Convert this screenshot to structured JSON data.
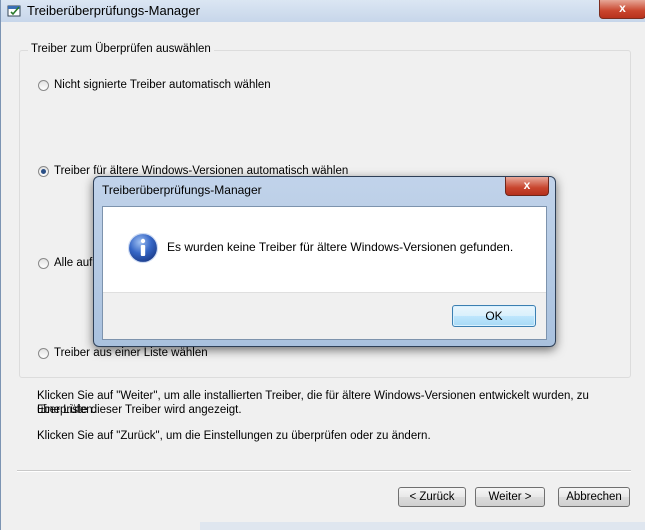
{
  "window": {
    "title": "Treiberüberprüfungs-Manager",
    "close_glyph": "x"
  },
  "group": {
    "legend": "Treiber zum Überprüfen auswählen",
    "options": [
      {
        "label": "Nicht signierte Treiber automatisch wählen",
        "checked": false
      },
      {
        "label": "Treiber für ältere Windows-Versionen automatisch wählen",
        "checked": true
      },
      {
        "label": "Alle auf d",
        "checked": false
      },
      {
        "label": "Treiber aus einer Liste wählen",
        "checked": false
      }
    ]
  },
  "description": {
    "line1": "Klicken Sie auf \"Weiter\", um alle installierten Treiber, die für ältere Windows-Versionen entwickelt wurden, zu überprüfen.",
    "line2": "Eine Liste dieser Treiber wird angezeigt.",
    "line3": "Klicken Sie auf \"Zurück\", um die Einstellungen zu überprüfen oder zu ändern."
  },
  "buttons": {
    "back": "< Zurück",
    "next": "Weiter >",
    "cancel": "Abbrechen"
  },
  "dialog": {
    "title": "Treiberüberprüfungs-Manager",
    "close_glyph": "x",
    "message": "Es wurden keine Treiber für ältere Windows-Versionen gefunden.",
    "ok_label": "OK",
    "icon": "info-icon"
  },
  "colors": {
    "titlebar": "#c7d6ea",
    "close_red": "#c9452d",
    "info_blue": "#2c5cb8",
    "ok_border": "#3c7fb1"
  }
}
